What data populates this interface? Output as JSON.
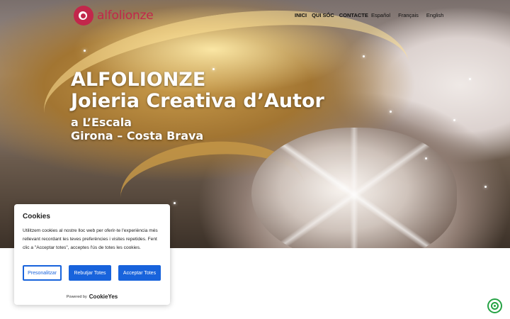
{
  "brand": {
    "name": "alfolionze",
    "color": "#c2274b"
  },
  "nav": {
    "items": [
      {
        "label": "INICI"
      },
      {
        "label": "QUI SÓC"
      },
      {
        "label": "CONTACTE"
      }
    ],
    "languages": [
      {
        "label": "Español"
      },
      {
        "label": "Français"
      },
      {
        "label": "English"
      }
    ]
  },
  "hero": {
    "line1": "ALFOLIONZE",
    "line2": "Joieria Creativa d’Autor",
    "line3": "a L’Escala",
    "line4": "Girona – Costa Brava"
  },
  "cookie_banner": {
    "title": "Cookies",
    "text": "Utilitzem cookies al nostre lloc web per oferir-te l'experiència més rellevant recordant les teves preferències i visites repetides. Fent clic a \"Acceptar totes\", acceptes l'ús de totes les cookies.",
    "customize_label": "Presonalitzar",
    "reject_label": "Rebutjar Totes",
    "accept_label": "Acceptar Totes",
    "powered_by": "Powered by",
    "provider": "CookieYes",
    "accent": "#1863dc"
  },
  "whatsapp": {
    "icon": "whatsapp-icon",
    "color": "#25a244"
  }
}
